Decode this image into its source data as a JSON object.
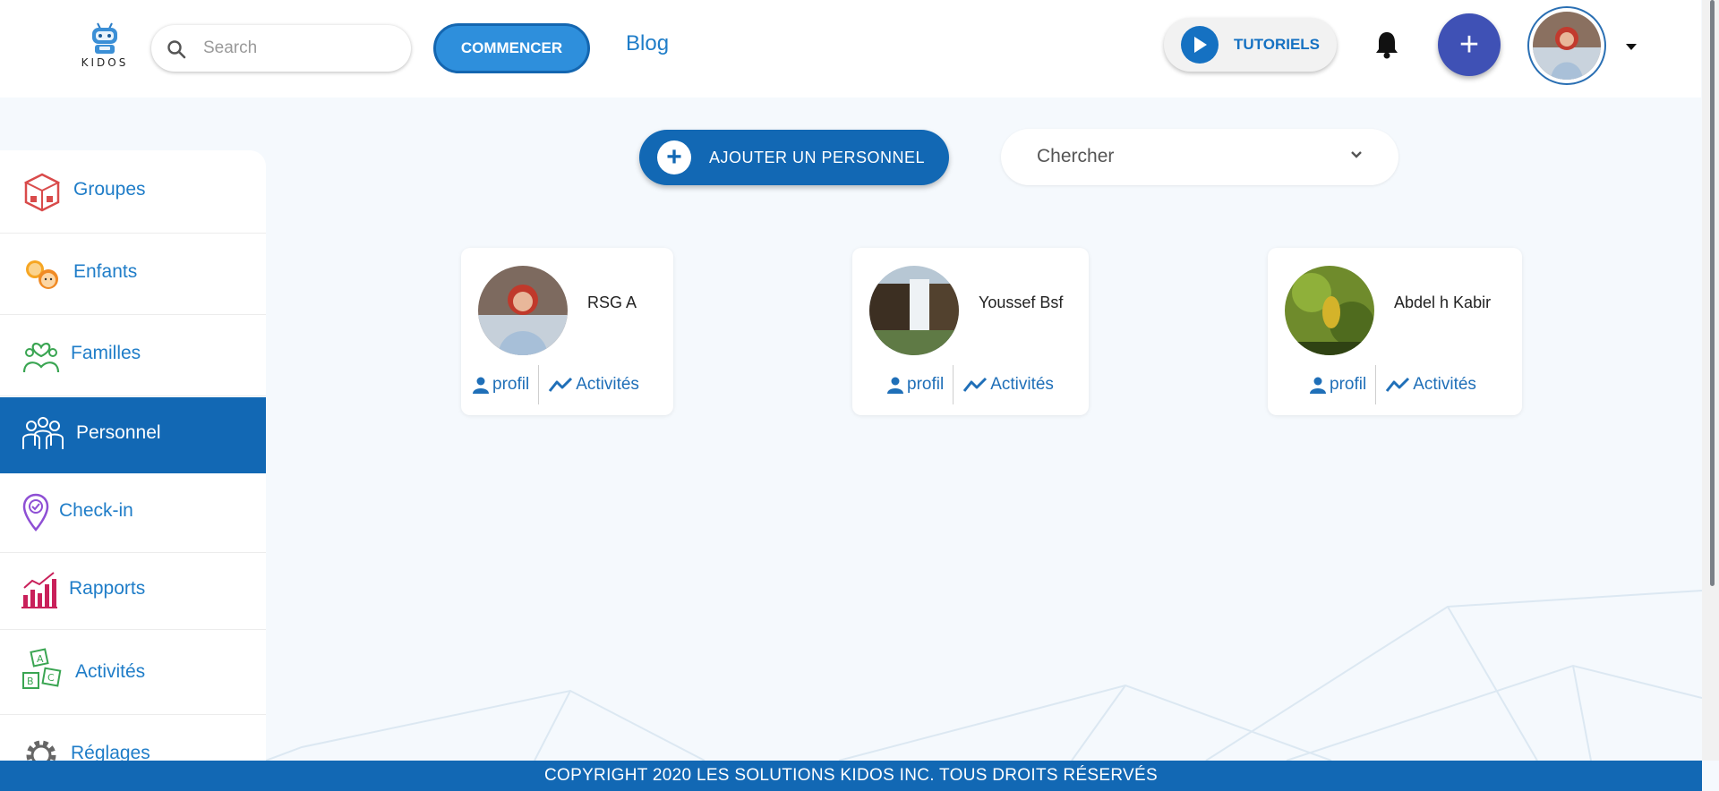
{
  "header": {
    "logo_text": "KIDOS",
    "search_placeholder": "Search",
    "commencer_label": "COMMENCER",
    "blog_label": "Blog",
    "tutoriels_label": "TUTORIELS",
    "add_label": "+"
  },
  "sidebar": {
    "items": [
      {
        "label": "Groupes",
        "icon": "groups-icon"
      },
      {
        "label": "Enfants",
        "icon": "children-icon"
      },
      {
        "label": "Familles",
        "icon": "families-icon"
      },
      {
        "label": "Personnel",
        "icon": "staff-icon",
        "active": true
      },
      {
        "label": "Check-in",
        "icon": "location-pin-icon"
      },
      {
        "label": "Rapports",
        "icon": "reports-icon"
      },
      {
        "label": "Activités",
        "icon": "abc-blocks-icon"
      },
      {
        "label": "Réglages",
        "icon": "gear-icon"
      }
    ]
  },
  "main": {
    "add_staff_label": "AJOUTER UN PERSONNEL",
    "search_select_value": "Chercher",
    "staff": [
      {
        "name": "RSG A",
        "profile_label": "profil",
        "activities_label": "Activités"
      },
      {
        "name": "Youssef Bsf",
        "profile_label": "profil",
        "activities_label": "Activités"
      },
      {
        "name": "Abdel h Kabir",
        "profile_label": "profil",
        "activities_label": "Activités"
      }
    ]
  },
  "footer": {
    "copyright": "COPYRIGHT 2020 LES SOLUTIONS KIDOS INC. TOUS DROITS RÉSERVÉS"
  },
  "colors": {
    "primary": "#1268b4",
    "link": "#1f7dc8",
    "accent_fab": "#3f51b5",
    "page_bg": "#f5f9fd"
  }
}
